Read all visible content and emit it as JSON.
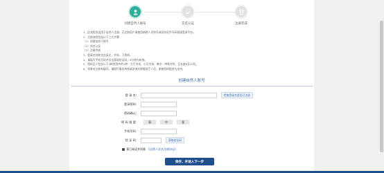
{
  "steps": [
    {
      "label": "创建自然人账号",
      "icon": "person-icon",
      "active": true
    },
    {
      "label": "实名认证",
      "icon": "check-icon",
      "active": false
    },
    {
      "label": "注册完成",
      "icon": "document-icon",
      "active": false
    }
  ],
  "notice": [
    "1、此流程仅适用于自然人注册，已注册用户请使用纳税人识别号或身份证件号码直接登录平台。",
    "2、注册流程包括以下三大步骤：",
    "（1）创建自然人账号",
    "（2）实名认证",
    "（3）注册完成",
    "3、登录名仅能包含英文、字母、下划线。",
    "4、请填写手机号码并点击获取验证码，5分钟内有效。",
    "5、密码至少包含以下4种类别中的3种：大写字母、小写字母、数字、特殊字符，且长度8至20位。",
    "6、如果对注册有疑问，请拨打服务热线或咨询办税服务厅人员，谢谢您的配合与支持。"
  ],
  "form": {
    "title": "创建自然人账号",
    "username_label": "登 录 名：",
    "check_button": "检查登录名是否已注册",
    "password_label": "登录密码：",
    "confirm_label": "密码确认：",
    "strength_label": "密 码 强 度：",
    "strength_levels": [
      "弱",
      "中",
      "强"
    ],
    "phone_label": "手机号码：",
    "code_label": "验 证 码：",
    "code_button": "获取验证码",
    "agree_text": "我已阅读并同意",
    "agree_link": "《自然人实名注册协议》",
    "submit_label": "保存，并进入下一步"
  },
  "colors": {
    "accent": "#2fae9c",
    "primary": "#1f4e8c",
    "link": "#3c6db0"
  }
}
